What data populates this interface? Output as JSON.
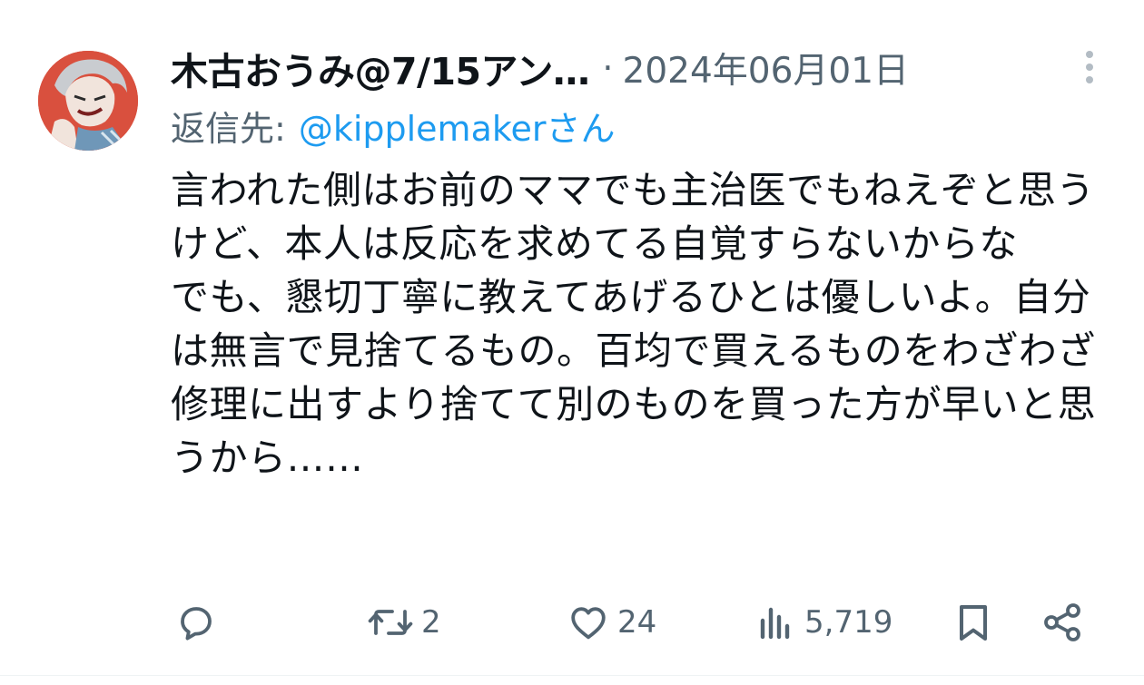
{
  "tweet": {
    "author_name": "木古おうみ@7/15アン…",
    "separator": "·",
    "date": "2024年06月01日",
    "reply_label": "返信先:",
    "reply_handle": "@kipplemakerさん",
    "body": "言われた側はお前のママでも主治医でもねえぞと思うけど、本人は反応を求めてる自覚すらないからな\nでも、懇切丁寧に教えてあげるひとは優しいよ。自分は無言で見捨てるもの。百均で買えるものをわざわざ修理に出すより捨てて別のものを買った方が早いと思うから……"
  },
  "actions": {
    "reply": {
      "icon": "reply-icon"
    },
    "retweet": {
      "icon": "retweet-icon",
      "count": "2"
    },
    "like": {
      "icon": "heart-icon",
      "count": "24"
    },
    "views": {
      "icon": "views-icon",
      "count": "5,719"
    },
    "bookmark": {
      "icon": "bookmark-icon"
    },
    "share": {
      "icon": "share-icon"
    }
  },
  "colors": {
    "text": "#0f1419",
    "secondary": "#536471",
    "link": "#1d9bf0"
  }
}
